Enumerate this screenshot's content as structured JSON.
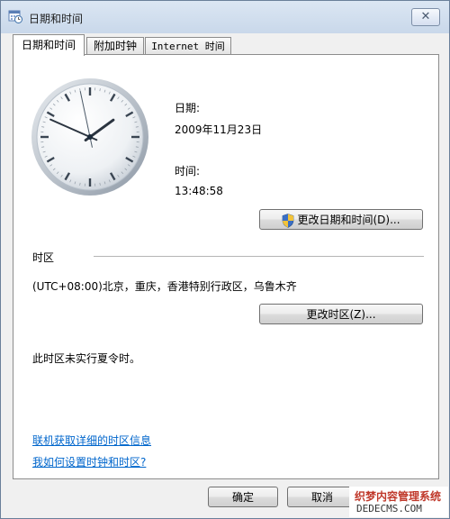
{
  "window": {
    "title": "日期和时间",
    "close_symbol": "✕"
  },
  "tabs": [
    {
      "label": "日期和时间",
      "active": true
    },
    {
      "label": "附加时钟",
      "active": false
    },
    {
      "label": "Internet 时间",
      "active": false
    }
  ],
  "clock": {
    "hour": 13,
    "minute": 48,
    "second": 58
  },
  "date": {
    "label": "日期:",
    "value": "2009年11月23日"
  },
  "time": {
    "label": "时间:",
    "value": "13:48:58"
  },
  "buttons": {
    "change_datetime": "更改日期和时间(D)...",
    "change_timezone": "更改时区(Z)...",
    "ok": "确定",
    "cancel": "取消"
  },
  "timezone": {
    "section_label": "时区",
    "value": "(UTC+08:00)北京，重庆，香港特别行政区，乌鲁木齐",
    "dst_note": "此时区未实行夏令时。"
  },
  "links": {
    "online_info": "联机获取详细的时区信息",
    "how_to": "我如何设置时钟和时区?"
  },
  "watermark": {
    "line1": "织梦内容管理系统",
    "line2": "DEDECMS.COM"
  },
  "colors": {
    "link": "#0066cc",
    "titlebar": "#c9d8ea",
    "panel": "#ffffff"
  }
}
